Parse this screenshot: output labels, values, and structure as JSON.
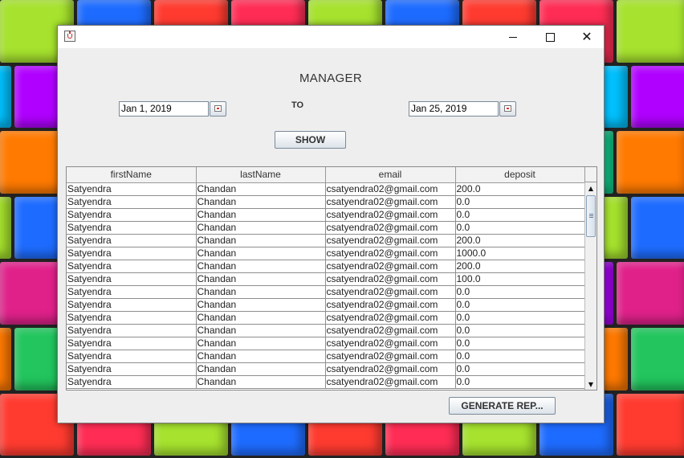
{
  "window": {
    "title": "",
    "heading": "MANAGER",
    "to_label": "TO",
    "from_date": "Jan 1, 2019",
    "to_date": "Jan 25, 2019",
    "show_button": "SHOW",
    "generate_button": "GENERATE REP..."
  },
  "table": {
    "columns": [
      "firstName",
      "lastName",
      "email",
      "deposit"
    ],
    "rows": [
      [
        "Satyendra",
        "Chandan",
        "csatyendra02@gmail.com",
        "200.0"
      ],
      [
        "Satyendra",
        "Chandan",
        "csatyendra02@gmail.com",
        "0.0"
      ],
      [
        "Satyendra",
        "Chandan",
        "csatyendra02@gmail.com",
        "0.0"
      ],
      [
        "Satyendra",
        "Chandan",
        "csatyendra02@gmail.com",
        "0.0"
      ],
      [
        "Satyendra",
        "Chandan",
        "csatyendra02@gmail.com",
        "200.0"
      ],
      [
        "Satyendra",
        "Chandan",
        "csatyendra02@gmail.com",
        "1000.0"
      ],
      [
        "Satyendra",
        "Chandan",
        "csatyendra02@gmail.com",
        "200.0"
      ],
      [
        "Satyendra",
        "Chandan",
        "csatyendra02@gmail.com",
        "100.0"
      ],
      [
        "Satyendra",
        "Chandan",
        "csatyendra02@gmail.com",
        "0.0"
      ],
      [
        "Satyendra",
        "Chandan",
        "csatyendra02@gmail.com",
        "0.0"
      ],
      [
        "Satyendra",
        "Chandan",
        "csatyendra02@gmail.com",
        "0.0"
      ],
      [
        "Satyendra",
        "Chandan",
        "csatyendra02@gmail.com",
        "0.0"
      ],
      [
        "Satyendra",
        "Chandan",
        "csatyendra02@gmail.com",
        "0.0"
      ],
      [
        "Satyendra",
        "Chandan",
        "csatyendra02@gmail.com",
        "0.0"
      ],
      [
        "Satyendra",
        "Chandan",
        "csatyendra02@gmail.com",
        "0.0"
      ],
      [
        "Satyendra",
        "Chandan",
        "csatyendra02@gmail.com",
        "0.0"
      ]
    ]
  },
  "icons": {
    "app": "java-cup-icon",
    "minimize": "minimize-icon",
    "maximize": "maximize-icon",
    "close": "close-icon",
    "calendar": "calendar-icon",
    "scroll_up": "arrow-up-icon",
    "scroll_down": "arrow-down-icon"
  },
  "colors": {
    "window_bg": "#eeeeee",
    "titlebar_bg": "#ffffff",
    "grid_line": "#8e8e8e"
  }
}
